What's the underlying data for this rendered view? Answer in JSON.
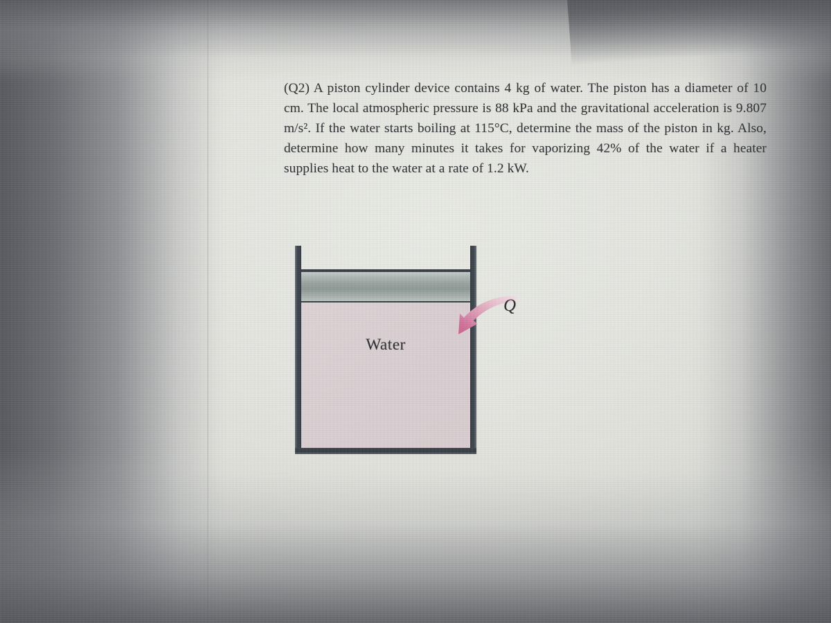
{
  "document": {
    "problem_label": "(Q2)",
    "problem_text": "(Q2) A piston cylinder device contains 4 kg of water. The piston has a diameter of 10 cm. The local atmospheric pressure is 88 kPa and the gravitational acceleration is 9.807 m/s². If the water starts boiling at 115°C, determine the mass of the piston in kg. Also, determine how many minutes it takes for vaporizing 42% of the water if a heater supplies heat to the water at a rate of 1.2 kW.",
    "given_values": {
      "mass_of_water": "4 kg",
      "piston_diameter": "10 cm",
      "atmospheric_pressure": "88 kPa",
      "gravitational_acceleration": "9.807 m/s²",
      "boiling_temperature": "115°C",
      "vaporized_fraction": "42%",
      "heater_power": "1.2 kW"
    }
  },
  "figure": {
    "water_label": "Water",
    "heat_label": "Q",
    "heat_arrow_icon": "curved-arrow-icon",
    "piston_icon": "piston-slab-icon",
    "cylinder_icon": "cylinder-walls-icon",
    "colors": {
      "water_fill": "#ddd1d4",
      "cylinder_wall": "#2f353d",
      "piston_light": "#cfd6d2",
      "piston_dark": "#8d9a96",
      "arrow_pink_dark": "#d2628d",
      "arrow_pink_light": "#f2d3dd",
      "paper": "#e8e9e3"
    }
  }
}
